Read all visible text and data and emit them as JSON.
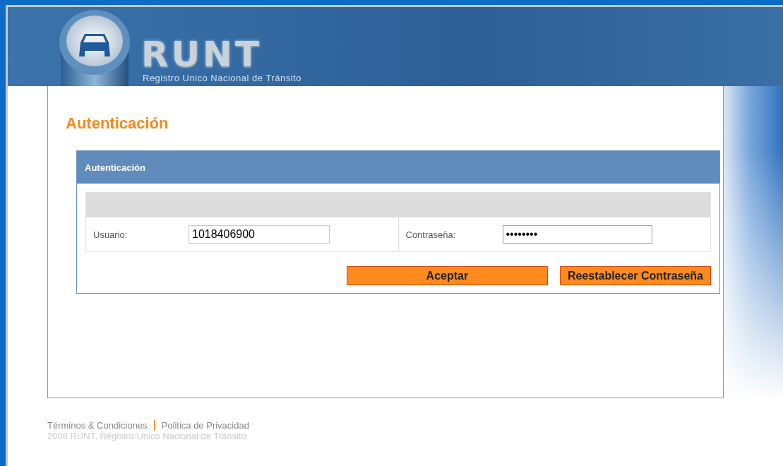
{
  "header": {
    "logo_text": "RUNT",
    "tagline": "Registro Unico Nacional de Tránsito"
  },
  "page_title": "Autenticación",
  "panel": {
    "title": "Autenticación",
    "fields": [
      {
        "label": "Usuario:",
        "value": "1018406900",
        "focused": false
      },
      {
        "label": "Contraseña:",
        "value": "••••••••",
        "focused": true
      }
    ],
    "buttons": [
      "Aceptar",
      "Reestablecer Contraseña"
    ]
  },
  "footer": {
    "links": [
      "Términos & Condiciones",
      "Politica de Privacidad"
    ],
    "copyright": "2008 RUNT, Registro Unico Nacional de Tránsito"
  }
}
